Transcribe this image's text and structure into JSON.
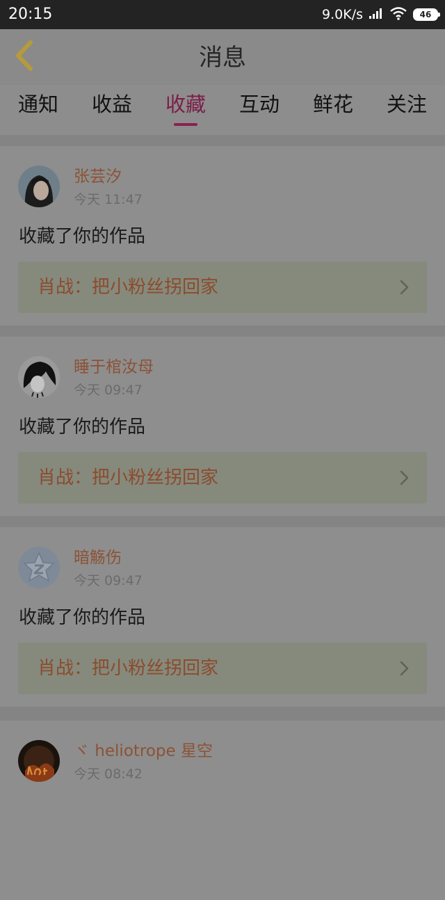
{
  "status_bar": {
    "time": "20:15",
    "net_speed": "9.0K/s",
    "battery": "46",
    "signal_icon": "signal-bars-icon",
    "wifi_icon": "wifi-icon",
    "battery_icon": "battery-icon"
  },
  "header": {
    "title": "消息",
    "back_icon": "chevron-left-icon",
    "accent_color": "#c9a43c"
  },
  "tabs": {
    "items": [
      {
        "label": "通知",
        "active": false
      },
      {
        "label": "收益",
        "active": false
      },
      {
        "label": "收藏",
        "active": true
      },
      {
        "label": "互动",
        "active": false
      },
      {
        "label": "鲜花",
        "active": false
      },
      {
        "label": "关注",
        "active": false
      }
    ],
    "active_color": "#8b1f52"
  },
  "messages": [
    {
      "user_name": "张芸汐",
      "time": "今天 11:47",
      "action": "收藏了你的作品",
      "work_title": "肖战：把小粉丝拐回家"
    },
    {
      "user_name": "睡于棺汝母",
      "time": "今天 09:47",
      "action": "收藏了你的作品",
      "work_title": "肖战：把小粉丝拐回家"
    },
    {
      "user_name": "暗觞伤",
      "time": "今天 09:47",
      "action": "收藏了你的作品",
      "work_title": "肖战：把小粉丝拐回家"
    },
    {
      "user_name": "ヾ heliotrope 星空",
      "time": "今天 08:42",
      "action": "",
      "work_title": ""
    }
  ],
  "colors": {
    "name_color": "#8c5236",
    "work_title_color": "#8c4b2d",
    "overlay_bg": "#8e8e8e"
  }
}
